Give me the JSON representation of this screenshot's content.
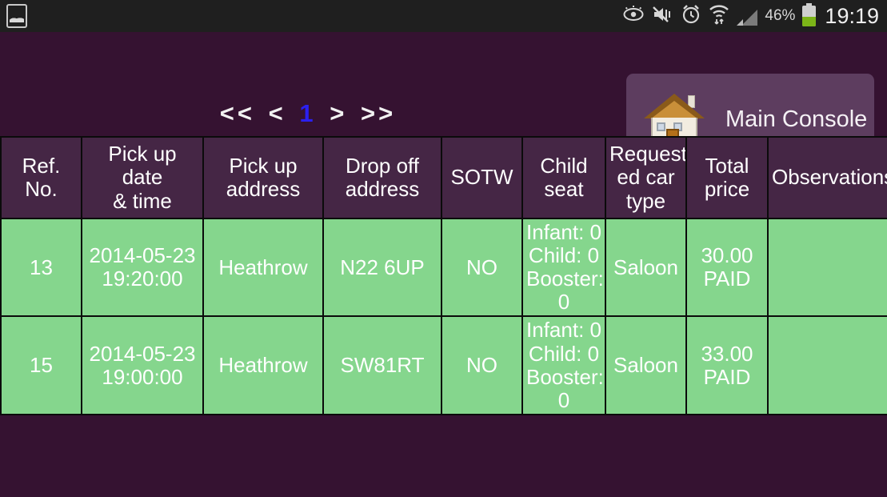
{
  "statusbar": {
    "left_icon": "gallery-icon",
    "icons": [
      "eye-icon",
      "mute-vibrate-icon",
      "alarm-clock-icon",
      "wifi-transfer-icon",
      "signal-bars-icon"
    ],
    "battery_percent": "46%",
    "clock": "19:19"
  },
  "toolbar": {
    "pager": {
      "first": "<<",
      "prev": "<",
      "current": "1",
      "next": ">",
      "last": ">>"
    },
    "console_button": {
      "label": "Main Console",
      "icon": "house-icon"
    }
  },
  "colors": {
    "background": "#351231",
    "header_cell": "#452645",
    "row_cell": "#85d68d",
    "button": "#5d3d5f",
    "pager_current": "#2b20ef",
    "statusbar": "#1f1f1f",
    "battery_fill": "#7cb518"
  },
  "table": {
    "headers": [
      "Ref. No.",
      "Pick up date\n& time",
      "Pick up\naddress",
      "Drop off\naddress",
      "SOTW",
      "Child\nseat",
      "Request\ned car\ntype",
      "Total\nprice",
      "Observations"
    ],
    "rows": [
      {
        "ref_no": "13",
        "pickup_datetime": "2014-05-23\n19:20:00",
        "pickup_address": "Heathrow",
        "dropoff_address": "N22 6UP",
        "sotw": "NO",
        "child_seat": "Infant: 0\nChild: 0\nBooster:\n0",
        "car_type": "Saloon",
        "total_price": "30.00\nPAID",
        "observations": ""
      },
      {
        "ref_no": "15",
        "pickup_datetime": "2014-05-23\n19:00:00",
        "pickup_address": "Heathrow",
        "dropoff_address": "SW81RT",
        "sotw": "NO",
        "child_seat": "Infant: 0\nChild: 0\nBooster:\n0",
        "car_type": "Saloon",
        "total_price": "33.00\nPAID",
        "observations": ""
      }
    ]
  }
}
